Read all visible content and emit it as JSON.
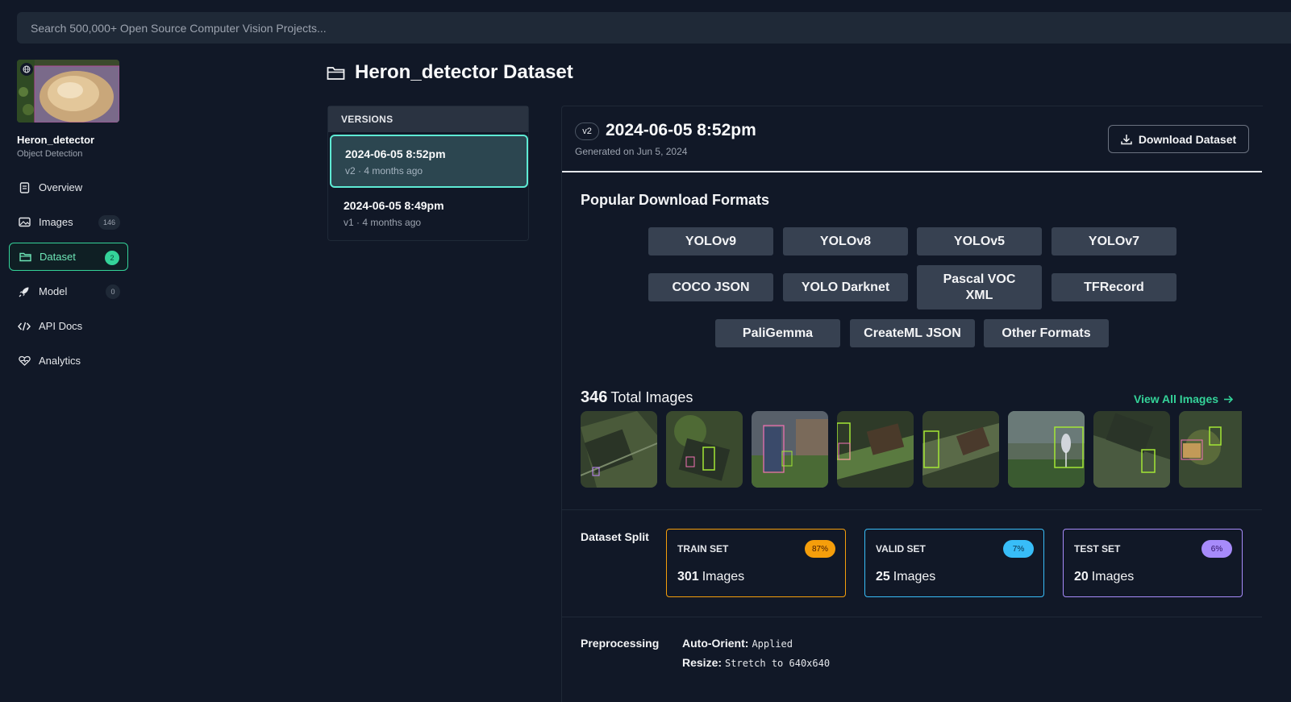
{
  "search": {
    "placeholder": "Search 500,000+ Open Source Computer Vision Projects..."
  },
  "project": {
    "name": "Heron_detector",
    "type": "Object Detection"
  },
  "nav": [
    {
      "label": "Overview",
      "icon": "document-icon"
    },
    {
      "label": "Images",
      "icon": "image-icon",
      "count": "146"
    },
    {
      "label": "Dataset",
      "icon": "folder-icon",
      "count": "2",
      "active": true
    },
    {
      "label": "Model",
      "icon": "rocket-icon",
      "count": "0"
    },
    {
      "label": "API Docs",
      "icon": "code-icon"
    },
    {
      "label": "Analytics",
      "icon": "heartbeat-icon"
    }
  ],
  "page_title": "Heron_detector Dataset",
  "versions": {
    "header": "VERSIONS",
    "items": [
      {
        "title": "2024-06-05 8:52pm",
        "version": "v2",
        "age": "4 months ago",
        "selected": true
      },
      {
        "title": "2024-06-05 8:49pm",
        "version": "v1",
        "age": "4 months ago"
      }
    ]
  },
  "version_detail": {
    "badge": "v2",
    "title": "2024-06-05 8:52pm",
    "generated": "Generated on Jun 5, 2024",
    "download_label": "Download Dataset"
  },
  "formats": {
    "title": "Popular Download Formats",
    "items": [
      "YOLOv9",
      "YOLOv8",
      "YOLOv5",
      "YOLOv7",
      "COCO JSON",
      "YOLO Darknet",
      "Pascal VOC XML",
      "TFRecord",
      "PaliGemma",
      "CreateML JSON",
      "Other Formats"
    ]
  },
  "images": {
    "total": "346",
    "label": "Total Images",
    "view_all": "View All Images"
  },
  "split": {
    "title": "Dataset Split",
    "sets": [
      {
        "name": "TRAIN SET",
        "pct": "87%",
        "count": "301",
        "unit": "Images",
        "color": "#f59e0b"
      },
      {
        "name": "VALID SET",
        "pct": "7%",
        "count": "25",
        "unit": "Images",
        "color": "#38bdf8"
      },
      {
        "name": "TEST SET",
        "pct": "6%",
        "count": "20",
        "unit": "Images",
        "color": "#a78bfa"
      }
    ]
  },
  "preprocessing": {
    "title": "Preprocessing",
    "items": [
      {
        "key": "Auto-Orient:",
        "value": "Applied"
      },
      {
        "key": "Resize:",
        "value": "Stretch to 640x640"
      }
    ]
  }
}
